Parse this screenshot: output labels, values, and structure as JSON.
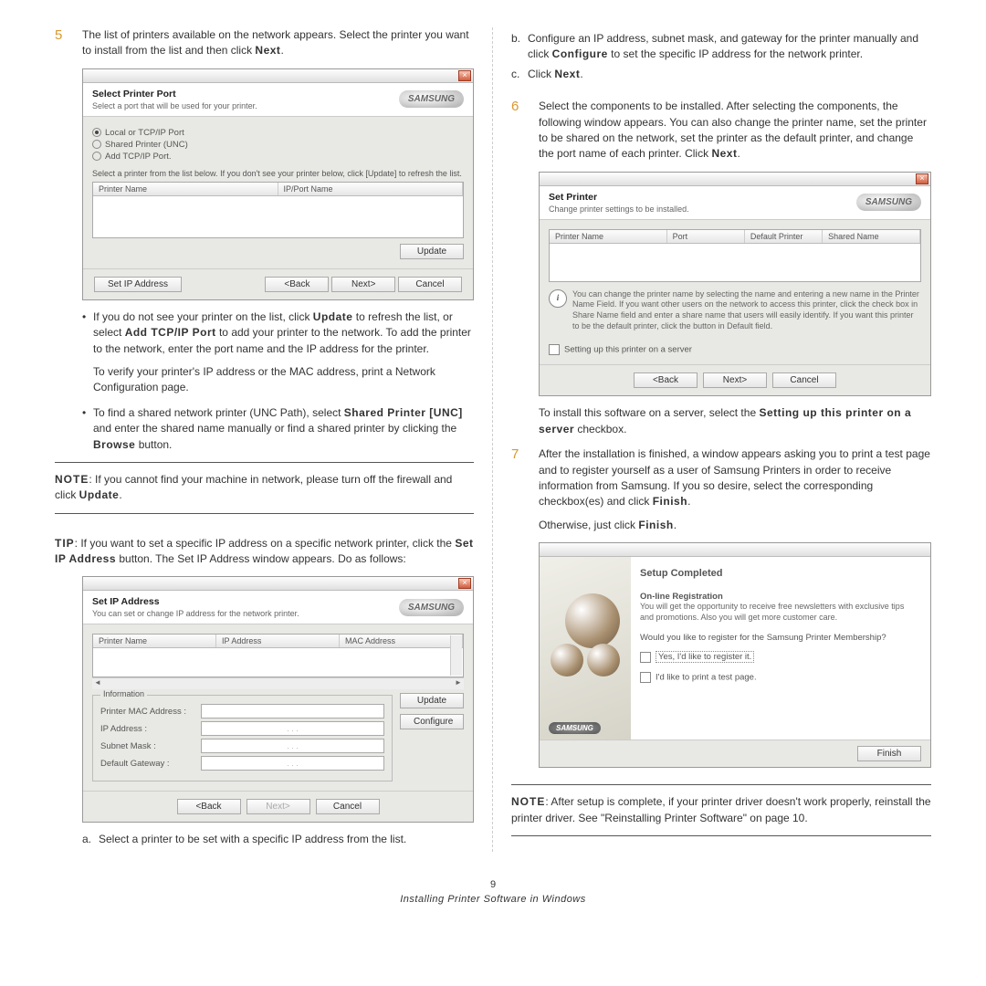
{
  "page": {
    "number": "9",
    "footer": "Installing Printer Software in Windows"
  },
  "step5": {
    "num": "5",
    "text_a": "The list of printers available on the network appears. Select the printer you want to install from the list and then click ",
    "text_b": "Next",
    "text_c": "."
  },
  "dlg1": {
    "title": "Select Printer Port",
    "subtitle": "Select a port that will be used for your printer.",
    "logo": "SAMSUNG",
    "opt1": "Local or TCP/IP Port",
    "opt2": "Shared Printer (UNC)",
    "opt3": "Add TCP/IP Port.",
    "hint": "Select a printer from the list below. If you don't see your printer below, click [Update] to refresh the list.",
    "col1": "Printer Name",
    "col2": "IP/Port Name",
    "update": "Update",
    "setip": "Set IP Address",
    "back": "<Back",
    "next": "Next>",
    "cancel": "Cancel",
    "close": "×"
  },
  "bullet1": {
    "a": "If you do not see your printer on the list, click ",
    "b": "Update",
    "c": " to refresh the list, or select ",
    "d": "Add TCP/IP Port",
    "e": " to add your printer to the network. To add the printer to the network, enter the port name and the IP address for the printer.",
    "f": "To verify your printer's IP address or the MAC address, print a Network Configuration page."
  },
  "bullet2": {
    "a": "To find a shared network printer (UNC Path), select ",
    "b": "Shared Printer [UNC]",
    "c": " and enter the shared name manually or find a shared printer by clicking the ",
    "d": "Browse",
    "e": " button."
  },
  "note1": {
    "lbl": "NOTE",
    "a": ": If you cannot find your machine in network, please turn off the firewall and click ",
    "b": "Update",
    "c": "."
  },
  "tip": {
    "lbl": "TIP",
    "a": ": If you want to set a specific IP address on a specific network printer, click the ",
    "b": "Set IP Address",
    "c": " button. The Set IP Address window appears. Do as follows:"
  },
  "dlg2": {
    "title": "Set IP Address",
    "subtitle": "You can set or change IP address for the network printer.",
    "col1": "Printer Name",
    "col2": "IP Address",
    "col3": "MAC Address",
    "group": "Information",
    "f1": "Printer MAC Address :",
    "f2": "IP Address :",
    "f3": "Subnet Mask :",
    "f4": "Default Gateway :",
    "update": "Update",
    "configure": "Configure",
    "back": "<Back",
    "next": "Next>",
    "cancel": "Cancel",
    "dots": ".       .       ."
  },
  "sub_a": {
    "l": "a.",
    "t": "Select a printer to be set with a specific IP address from the list."
  },
  "sub_b": {
    "l": "b.",
    "a": "Configure an IP address, subnet mask, and gateway for the printer manually and click ",
    "b": "Configure",
    "c": " to set the specific IP address for the network printer."
  },
  "sub_c": {
    "l": "c.",
    "a": "Click ",
    "b": "Next",
    "c": "."
  },
  "step6": {
    "num": "6",
    "a": "Select the components to be installed. After selecting the components, the following window appears. You can also change the printer name, set the printer to be shared on the network, set the printer as the default printer, and change the port name of each printer. Click ",
    "b": "Next",
    "c": "."
  },
  "dlg3": {
    "title": "Set Printer",
    "subtitle": "Change printer settings to be installed.",
    "col1": "Printer Name",
    "col2": "Port",
    "col3": "Default Printer",
    "col4": "Shared Name",
    "info": "You can change the printer name by selecting the name and entering a new name in the Printer Name Field. If you want other users on the network to access this printer, click the check box in Share Name field and enter a share name that users will easily identify. If you want this printer to be the default printer, click the button in Default field.",
    "srv": "Setting up this printer on a server",
    "back": "<Back",
    "next": "Next>",
    "cancel": "Cancel"
  },
  "after_dlg3": {
    "a": "To install this software on a server, select the ",
    "b": "Setting up this printer on a server",
    "c": " checkbox."
  },
  "step7": {
    "num": "7",
    "a": "After the installation is finished, a window appears asking you to print a test page and to register yourself as a user of Samsung Printers in order to receive information from Samsung. If you so desire, select the corresponding checkbox(es) and click ",
    "b": "Finish",
    "c": ".",
    "d": "Otherwise, just click ",
    "e": "Finish",
    "f": "."
  },
  "dlg4": {
    "title": "Setup Completed",
    "reg_t": "On-line Registration",
    "reg_d": "You will get the opportunity to receive free newsletters with exclusive tips and promotions. Also you will get more customer care.",
    "q": "Would you like to register for the Samsung Printer Membership?",
    "c1": "Yes, I'd like to register it.",
    "c2": "I'd like to print a test page.",
    "finish": "Finish",
    "logo": "SAMSUNG"
  },
  "note2": {
    "lbl": "NOTE",
    "t": ": After setup is complete, if your printer driver doesn't work properly, reinstall the printer driver. See \"Reinstalling Printer Software\" on page 10."
  }
}
